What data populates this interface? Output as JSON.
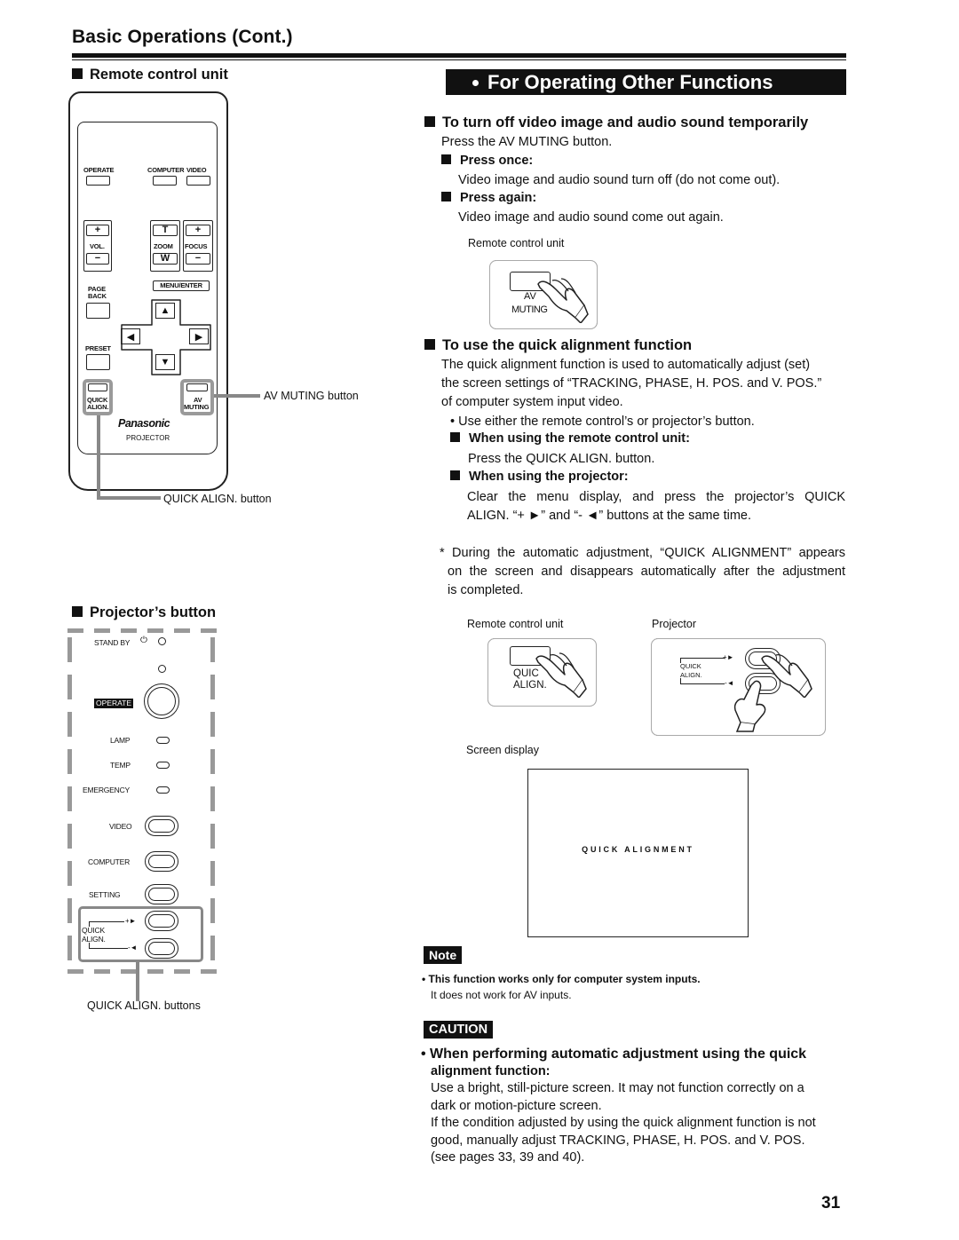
{
  "header": {
    "title": "Basic Operations (Cont.)"
  },
  "left": {
    "remote_section_title": "Remote control unit",
    "remote": {
      "operate_label": "OPERATE",
      "computer_label": "COMPUTER",
      "video_label": "VIDEO",
      "vol_label": "VOL.",
      "zoom_label": "ZOOM",
      "focus_label": "FOCUS",
      "plus": "+",
      "minus": "−",
      "zoom_t": "T",
      "zoom_w": "W",
      "menu_enter_label": "MENU/ENTER",
      "page_back_label": "PAGE\nBACK",
      "page_label": "PAGE",
      "back_label": "BACK",
      "preset_label": "PRESET",
      "up": "▲",
      "down": "▼",
      "left": "◀",
      "right": "▶",
      "quick_label": "QUICK",
      "align_label": "ALIGN.",
      "av_label": "AV",
      "muting_label": "MUTING",
      "brand": "Panasonic",
      "model": "PROJECTOR"
    },
    "callouts": {
      "av_muting": "AV MUTING button",
      "quick_align": "QUICK ALIGN. button"
    },
    "projector_section_title": "Projector’s  button",
    "projector": {
      "standby_label": "STAND BY",
      "power_glyph": "⏻",
      "operate_label": "OPERATE",
      "lamp_label": "LAMP",
      "temp_label": "TEMP",
      "emergency_label": "EMERGENCY",
      "video_label": "VIDEO",
      "computer_label": "COMPUTER",
      "setting_label": "SETTING",
      "quick_label": "QUICK",
      "align_label": "ALIGN.",
      "plus_marker": "+►",
      "minus_marker": "-◄"
    },
    "projector_callout": "QUICK ALIGN. buttons"
  },
  "right": {
    "banner": "For Operating Other Functions",
    "sec1": {
      "title": "To turn off video image and audio sound temporarily",
      "intro": "Press the AV MUTING button.",
      "press_once_title": "Press once:",
      "press_once_text": "Video image and audio sound turn off (do not come out).",
      "press_again_title": "Press again:",
      "press_again_text": "Video image and audio sound come out again.",
      "illus_caption": "Remote control unit",
      "illus_av": "AV",
      "illus_muting": "MUTING"
    },
    "sec2": {
      "title": "To use the quick alignment function",
      "para_lines": [
        "The quick alignment function is used to automatically adjust (set)",
        "the screen settings of “TRACKING, PHASE, H. POS. and V. POS.”",
        "of computer system input video."
      ],
      "bullet": "• Use either the remote control’s or projector’s button.",
      "remote_title": "When using the remote control unit:",
      "remote_text": "Press the QUICK ALIGN. button.",
      "projector_title": "When using the projector:",
      "projector_lines": [
        "Clear the menu display, and press the projector’s QUICK",
        "ALIGN. “+ ►” and “- ◄” buttons at the same time."
      ],
      "note_lines": [
        "* During the automatic adjustment, “QUICK ALIGNMENT” appears",
        "on the screen and disappears automatically after the adjustment",
        "is completed."
      ],
      "illus_remote_caption": "Remote control unit",
      "illus_projector_caption": "Projector",
      "illus_quic": "QUIC",
      "illus_align": "ALIGN.",
      "illus_p_quick": "QUICK",
      "illus_p_align": "ALIGN.",
      "illus_p_plus": "+►",
      "illus_p_minus": "-◄",
      "screen_caption": "Screen display",
      "screen_text": "QUICK ALIGNMENT"
    },
    "note": {
      "tag": "Note",
      "bold_line": "• This function works only for computer system inputs.",
      "line2": "It does not work for AV inputs."
    },
    "caution": {
      "tag": "CAUTION",
      "title_line1": "• When performing automatic adjustment using the quick",
      "title_line2": "alignment  function:",
      "lines": [
        "Use a bright, still-picture screen. It may not function correctly on a",
        "dark or motion-picture screen.",
        "If the condition adjusted by using the quick alignment function is not",
        "good, manually adjust TRACKING, PHASE, H. POS. and V. POS.",
        "(see pages 33, 39 and 40)."
      ]
    }
  },
  "page_number": "31"
}
